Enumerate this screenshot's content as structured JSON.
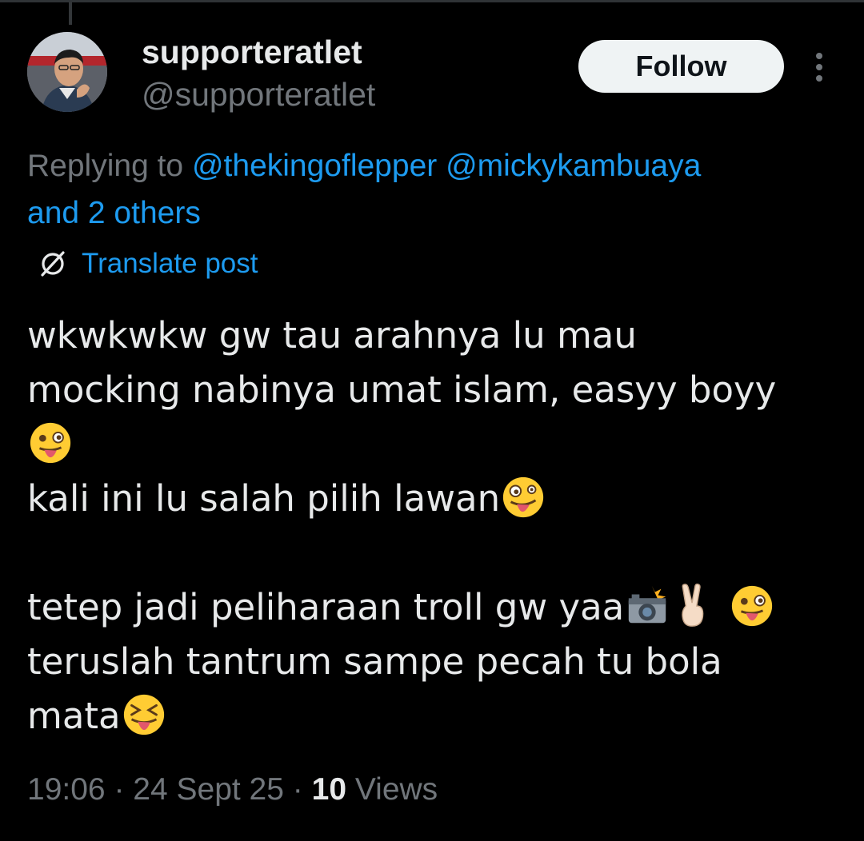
{
  "author": {
    "display_name": "supporteratlet",
    "handle": "@supporteratlet"
  },
  "actions": {
    "follow_label": "Follow",
    "more_icon": "more-vertical-icon"
  },
  "reply": {
    "prefix": "Replying to ",
    "mention_1": "@thekingoflepper",
    "mention_2": "@mickykambuaya",
    "others": "and 2 others"
  },
  "translate": {
    "label": "Translate post",
    "icon": "translate-icon"
  },
  "post": {
    "line_1": "wkwkwkw gw tau arahnya lu mau",
    "line_2": "mocking nabinya umat islam, easyy boyy",
    "line_4": "kali ini lu salah pilih lawan",
    "line_6": "tetep jadi peliharaan troll gw yaa",
    "line_7": "teruslah tantrum sampe pecah tu bola",
    "line_8": "mata",
    "emojis": [
      "winking-tongue-emoji",
      "zany-face-emoji",
      "camera-flash-emoji",
      "victory-hand-emoji",
      "winking-tongue-emoji",
      "squinting-tongue-emoji"
    ]
  },
  "meta": {
    "time": "19:06",
    "sep": " · ",
    "date": "24 Sept 25",
    "views_count": "10",
    "views_label": " Views"
  },
  "colors": {
    "background": "#000000",
    "text": "#e7e9ea",
    "secondary": "#71767b",
    "link": "#1d9bf0",
    "follow_bg": "#eff3f4"
  }
}
